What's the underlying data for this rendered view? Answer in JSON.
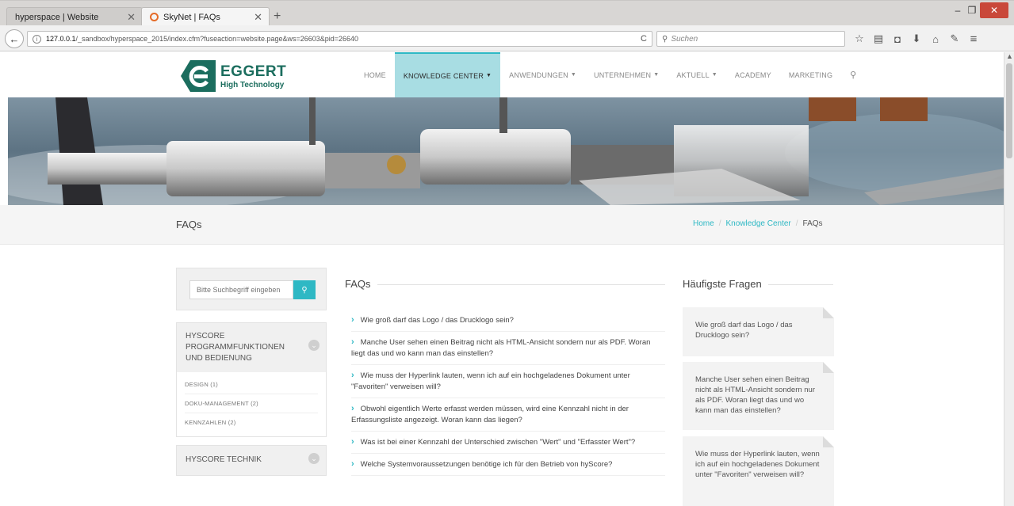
{
  "browser": {
    "tabs": [
      {
        "label": "hyperspace | Website",
        "active": false
      },
      {
        "label": "SkyNet | FAQs",
        "active": true
      }
    ],
    "new_tab": "+",
    "url": {
      "host": "127.0.0.1",
      "path": "/_sandbox/hyperspace_2015/index.cfm?fuseaction=website.page&ws=26603&pid=26640"
    },
    "search_placeholder": "Suchen",
    "window_controls": {
      "minimize": "–",
      "maximize": "❐",
      "close": "✕"
    }
  },
  "site": {
    "logo": {
      "brand": "EGGERT",
      "tagline": "High Technology",
      "color": "#1b6d5e"
    },
    "nav": [
      {
        "label": "HOME",
        "caret": false,
        "active": false
      },
      {
        "label": "KNOWLEDGE CENTER",
        "caret": true,
        "active": true
      },
      {
        "label": "ANWENDUNGEN",
        "caret": true,
        "active": false
      },
      {
        "label": "UNTERNEHMEN",
        "caret": true,
        "active": false
      },
      {
        "label": "AKTUELL",
        "caret": true,
        "active": false
      },
      {
        "label": "ACADEMY",
        "caret": false,
        "active": false
      },
      {
        "label": "MARKETING",
        "caret": false,
        "active": false
      }
    ],
    "accent_color": "#2eb8c4"
  },
  "page": {
    "title": "FAQs",
    "breadcrumb": {
      "home": "Home",
      "section": "Knowledge Center",
      "current": "FAQs"
    }
  },
  "sidebar": {
    "search_placeholder": "Bitte Suchbegriff eingeben",
    "categories": [
      {
        "title": "HYSCORE PROGRAMMFUNKTIONEN UND BEDIENUNG",
        "items": [
          "DESIGN (1)",
          "DOKU-MANAGEMENT (2)",
          "KENNZAHLEN (2)"
        ]
      },
      {
        "title": "HYSCORE TECHNIK",
        "items": []
      }
    ]
  },
  "main": {
    "heading": "FAQs",
    "faqs": [
      "Wie groß darf das Logo / das Drucklogo sein?",
      "Manche User sehen einen Beitrag nicht als HTML-Ansicht sondern nur als PDF. Woran liegt das und wo kann man das einstellen?",
      "Wie muss der Hyperlink lauten, wenn ich auf ein hochgeladenes Dokument unter \"Favoriten\" verweisen will?",
      "Obwohl eigentlich Werte erfasst werden müssen, wird eine Kennzahl nicht in der Erfassungsliste angezeigt. Woran kann das liegen?",
      "Was ist bei einer Kennzahl der Unterschied zwischen \"Wert\" und \"Erfasster Wert\"?",
      "Welche Systemvoraussetzungen benötige ich für den Betrieb von hyScore?"
    ]
  },
  "aside": {
    "heading": "Häufigste Fragen",
    "cards": [
      "Wie groß darf das Logo / das Drucklogo sein?",
      "Manche User sehen einen Beitrag nicht als HTML-Ansicht sondern nur als PDF. Woran liegt das und wo kann man das einstellen?",
      "Wie muss der Hyperlink lauten, wenn ich auf ein hochgeladenes Dokument unter \"Favoriten\" verweisen will?"
    ]
  }
}
